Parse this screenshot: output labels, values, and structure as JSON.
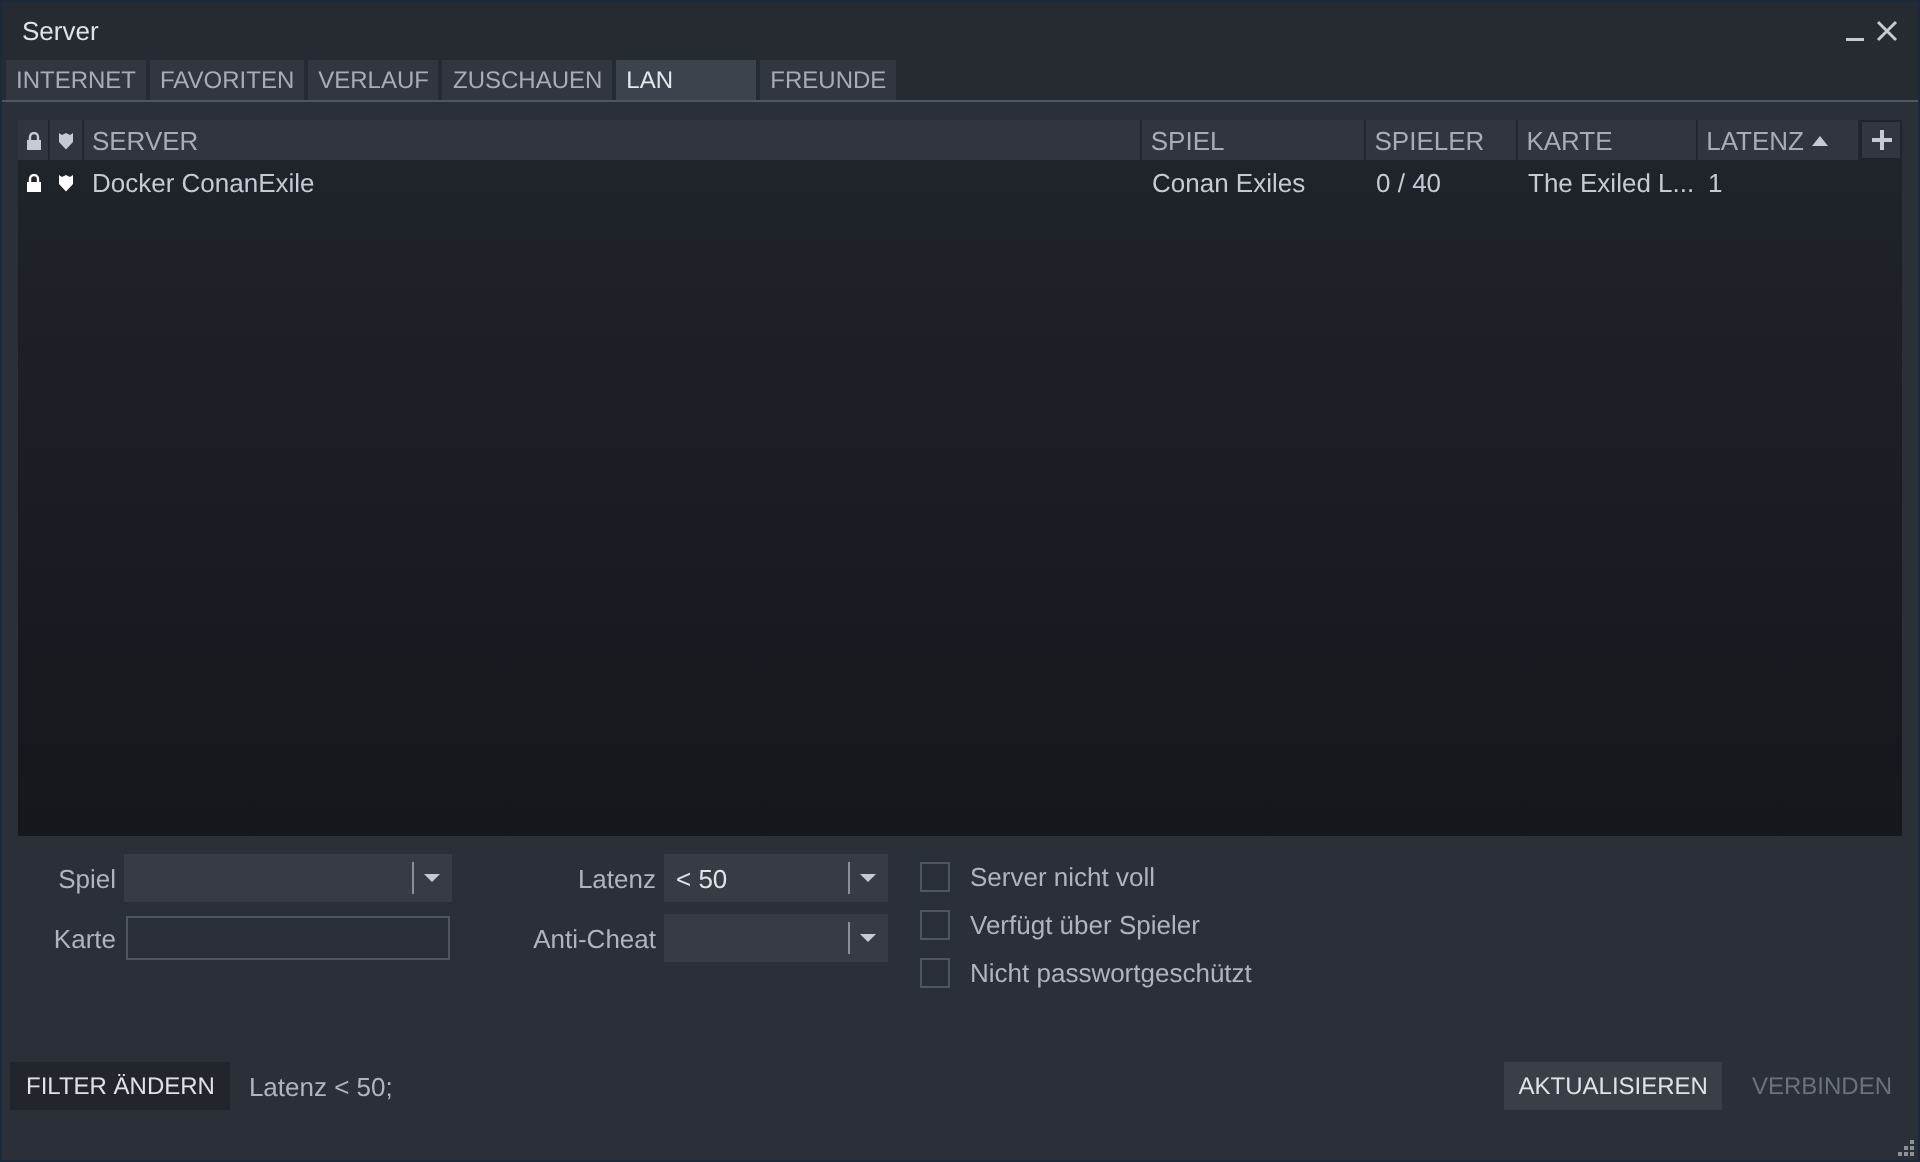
{
  "window": {
    "title": "Server"
  },
  "tabs": [
    {
      "label": "INTERNET",
      "selected": false
    },
    {
      "label": "FAVORITEN",
      "selected": false
    },
    {
      "label": "VERLAUF",
      "selected": false
    },
    {
      "label": "ZUSCHAUEN",
      "selected": false
    },
    {
      "label": "LAN",
      "selected": true
    },
    {
      "label": "FREUNDE",
      "selected": false
    }
  ],
  "table": {
    "columns": [
      {
        "kind": "lock"
      },
      {
        "kind": "shield"
      },
      {
        "kind": "text",
        "label": "SERVER",
        "sorted": false
      },
      {
        "kind": "text",
        "label": "SPIEL",
        "sorted": false
      },
      {
        "kind": "text",
        "label": "SPIELER",
        "sorted": false
      },
      {
        "kind": "text",
        "label": "KARTE",
        "sorted": false
      },
      {
        "kind": "text",
        "label": "LATENZ",
        "sorted": true
      }
    ],
    "rows": [
      {
        "password": true,
        "secure": true,
        "server": "Docker ConanExile",
        "game": "Conan Exiles",
        "players": "0 / 40",
        "map": "The Exiled L...",
        "latency": "1"
      }
    ]
  },
  "filters": {
    "game": {
      "label": "Spiel"
    },
    "map": {
      "label": "Karte"
    },
    "latency": {
      "label": "Latenz",
      "value": "< 50"
    },
    "anticheat": {
      "label": "Anti-Cheat"
    },
    "checkboxes": [
      {
        "label": "Server nicht voll",
        "checked": false
      },
      {
        "label": "Verfügt über Spieler",
        "checked": false
      },
      {
        "label": "Nicht passwortgeschützt",
        "checked": false
      }
    ]
  },
  "status_bar": {
    "filter_button": "FILTER ÄNDERN",
    "summary": "Latenz < 50;",
    "buttons": [
      {
        "label": "AKTUALISIEREN",
        "disabled": false
      },
      {
        "label": "VERBINDEN",
        "disabled": true
      }
    ]
  }
}
